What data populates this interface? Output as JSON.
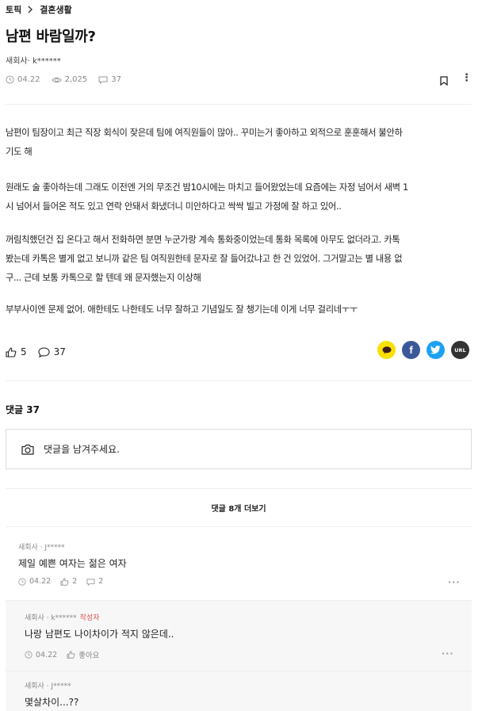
{
  "breadcrumb": {
    "root": "토픽",
    "category": "결혼생활"
  },
  "post": {
    "title": "남편 바람일까?",
    "author": "새회사· k******",
    "date": "04.22",
    "views": "2,025",
    "comments": "37",
    "paragraphs": [
      [
        "남편이 팀장이고 최근 직장 회식이 잦은데 팀에 여직원들이 많아.. 꾸미는거 좋아하고 외적으로 훈훈해서 불안하",
        "기도 해"
      ],
      [
        "원래도 술 좋아하는데 그래도 이전엔 거의 무조건 밤10시에는 마치고 들어왔었는데 요즘에는 자정 넘어서 새벽 1",
        "시 넘어서 들어온 적도 있고 연락 안돼서 화냈더니 미안하다고 싹싹 빌고 가정에 잘 하고 있어.."
      ],
      [
        "꺼림칙했던건 집 온다고 해서 전화하면 분면 누군가랑 계속 통화중이었는데 통화 목록에 아무도 없더라고. 카톡",
        "봤는데 카톡은 별게 없고 보니까 같은 팀 여직원한테 문자로 잘 들어갔냐고 한 건 있었어. 그거말고는 별 내용 없",
        "구... 근데 보통 카톡으로 할 텐데 왜 문자했는지 이상해"
      ],
      [
        "부부사이엔 문제 없어. 애한테도 나한테도 너무 잘하고 기념일도 잘 챙기는데 이게 너무 걸리네ㅜㅜ"
      ]
    ],
    "likes": "5",
    "comment_count": "37"
  },
  "share": {
    "kakao_icon": "kakao-icon",
    "facebook_label": "f",
    "url_label": "URL"
  },
  "comments_section": {
    "heading": "댓글 37",
    "placeholder": "댓글을 남겨주세요.",
    "more_label": "댓글 8개 더보기",
    "items": [
      {
        "author": "새회사 · J*****",
        "tag": "",
        "text": "제일 예쁜 여자는 젊은 여자",
        "date": "04.22",
        "likes": "2",
        "replies": "2"
      },
      {
        "author": "새회사 · k******",
        "tag": "작성자",
        "text": "나랑 남편도 나이차이가 적지 않은데..",
        "date": "04.22",
        "likes": "좋아요"
      },
      {
        "author": "새회사 · J*****",
        "tag": "",
        "text": "몇살차이...??"
      }
    ]
  },
  "colors": {
    "kakao": "#f9e000",
    "facebook": "#3b5998",
    "twitter": "#1da1f2",
    "url": "#333333",
    "author_tag": "#d9534f"
  }
}
